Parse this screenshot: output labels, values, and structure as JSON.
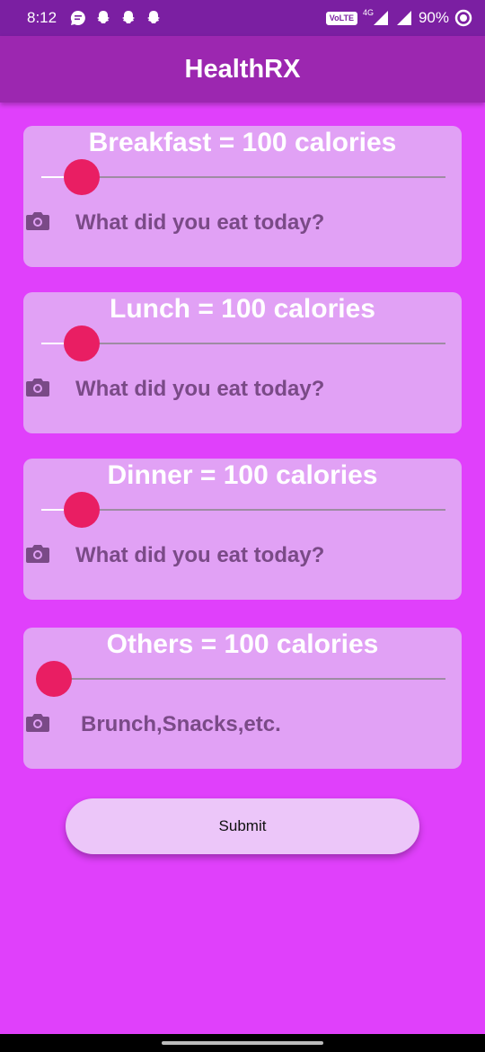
{
  "status_bar": {
    "time": "8:12",
    "volte": "VoLTE",
    "network": "4G",
    "battery": "90%",
    "icons": [
      "message-icon",
      "snapchat-icon",
      "snapchat-icon",
      "snapchat-icon",
      "signal-icon",
      "battery-icon"
    ]
  },
  "app_bar": {
    "title": "HealthRX"
  },
  "meals": [
    {
      "title": "Breakfast = 100 calories",
      "placeholder": "What did you eat today?",
      "slider_value": 100
    },
    {
      "title": "Lunch = 100 calories",
      "placeholder": "What did you eat today?",
      "slider_value": 100
    },
    {
      "title": "Dinner = 100 calories",
      "placeholder": "What did you eat today?",
      "slider_value": 100
    },
    {
      "title": "Others = 100 calories",
      "placeholder": "Brunch,Snacks,etc.",
      "slider_value": 100
    }
  ],
  "submit_label": "Submit",
  "colors": {
    "background": "#e040fb",
    "app_bar": "#9c27b0",
    "status_bar": "#7b1fa2",
    "card": "#e1a1f5",
    "slider_thumb": "#e91e63",
    "submit_button": "#ecc6f9"
  }
}
